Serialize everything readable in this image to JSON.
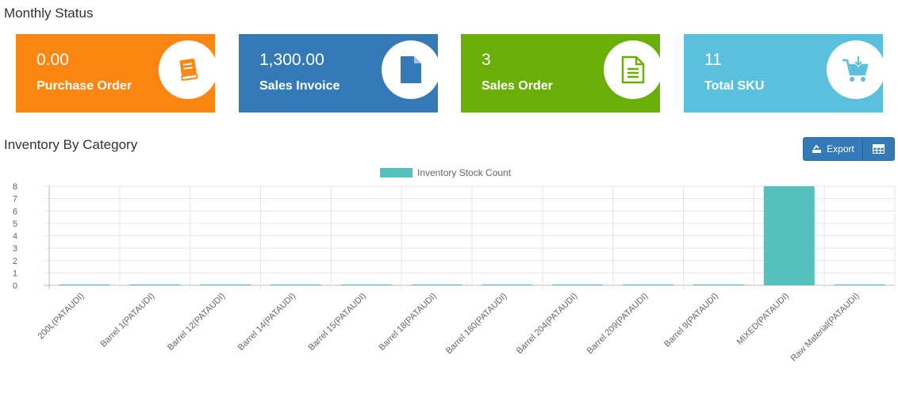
{
  "monthly": {
    "title": "Monthly Status",
    "cards": [
      {
        "value": "0.00",
        "label": "Purchase Order",
        "color": "#fd8512",
        "icon": "book-icon"
      },
      {
        "value": "1,300.00",
        "label": "Sales Invoice",
        "color": "#337ab7",
        "icon": "document-icon"
      },
      {
        "value": "3",
        "label": "Sales Order",
        "color": "#6aaf08",
        "icon": "document-lines-icon"
      },
      {
        "value": "11",
        "label": "Total SKU",
        "color": "#5bc0de",
        "icon": "cart-download-icon"
      }
    ]
  },
  "inventory": {
    "title": "Inventory By Category",
    "export_label": "Export",
    "table_icon": "table-icon"
  },
  "chart_data": {
    "type": "bar",
    "categories": [
      "200L(PATAUDI)",
      "Barrel 1(PATAUDI)",
      "Barrel 12(PATAUDI)",
      "Barrel 14(PATAUDI)",
      "Barrel 15(PATAUDI)",
      "Barrel 18(PATAUDI)",
      "Barrel 180(PATAUDI)",
      "Barrel 204(PATAUDI)",
      "Barrel 209(PATAUDI)",
      "Barrel 9(PATAUDI)",
      "MIXED(PATAUDI)",
      "Raw Material(PATAUDI)"
    ],
    "series": [
      {
        "name": "Inventory Stock Count",
        "values": [
          0,
          0,
          0,
          0,
          0,
          0,
          0,
          0,
          0,
          0,
          8,
          0
        ],
        "color": "#55c1bf"
      }
    ],
    "ylim": [
      0,
      8
    ],
    "yticks": [
      0,
      1,
      2,
      3,
      4,
      5,
      6,
      7,
      8
    ],
    "grid": true,
    "legend": "top-center"
  }
}
